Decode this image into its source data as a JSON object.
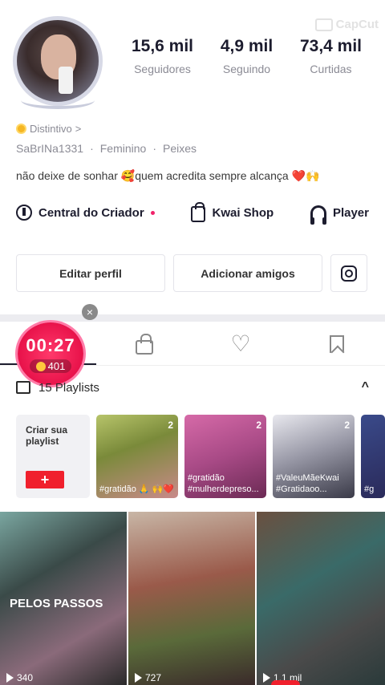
{
  "watermark": "CapCut",
  "profile": {
    "stats": [
      {
        "value": "15,6 mil",
        "label": "Seguidores"
      },
      {
        "value": "4,9 mil",
        "label": "Seguindo"
      },
      {
        "value": "73,4 mil",
        "label": "Curtidas"
      }
    ],
    "badge": "Distintivo",
    "badge_chevron": ">",
    "username": "SaBrINa1331",
    "gender": "Feminino",
    "sign": "Peixes",
    "separator": "·",
    "bio_text_1": "não deixe de sonhar ",
    "bio_emoji_1": "🥰",
    "bio_text_2": "quem acredita sempre alcança ",
    "bio_heart": "❤️",
    "bio_hands": "🙌"
  },
  "links": {
    "creator_center": "Central do Criador",
    "kwai_shop": "Kwai Shop",
    "player": "Player"
  },
  "actions": {
    "edit_profile": "Editar perfil",
    "add_friends": "Adicionar amigos"
  },
  "timer": {
    "time": "00:27",
    "coins": "401",
    "close": "×"
  },
  "tabs": [
    "posts",
    "private",
    "liked",
    "saved"
  ],
  "playlists": {
    "header": "15 Playlists",
    "chevron": "^",
    "create_label": "Criar sua playlist",
    "create_plus": "+",
    "cards": [
      {
        "count": "2",
        "caption": "#gratidão 🙏 🙌❤️"
      },
      {
        "count": "2",
        "caption": "#gratidão #mulherdepreso..."
      },
      {
        "count": "2",
        "caption": "#ValeuMãeKwai #Gratidaoo..."
      },
      {
        "count": "",
        "caption": "#g"
      }
    ]
  },
  "videos": [
    {
      "title": "PELOS PASSOS",
      "views": "340"
    },
    {
      "title": "",
      "views": "727"
    },
    {
      "title": "",
      "views": "1,1 mil"
    }
  ],
  "colors": {
    "accent": "#f0202d",
    "timer": "#e8124a",
    "text_primary": "#1c1c2e",
    "text_secondary": "#8b8b95"
  }
}
